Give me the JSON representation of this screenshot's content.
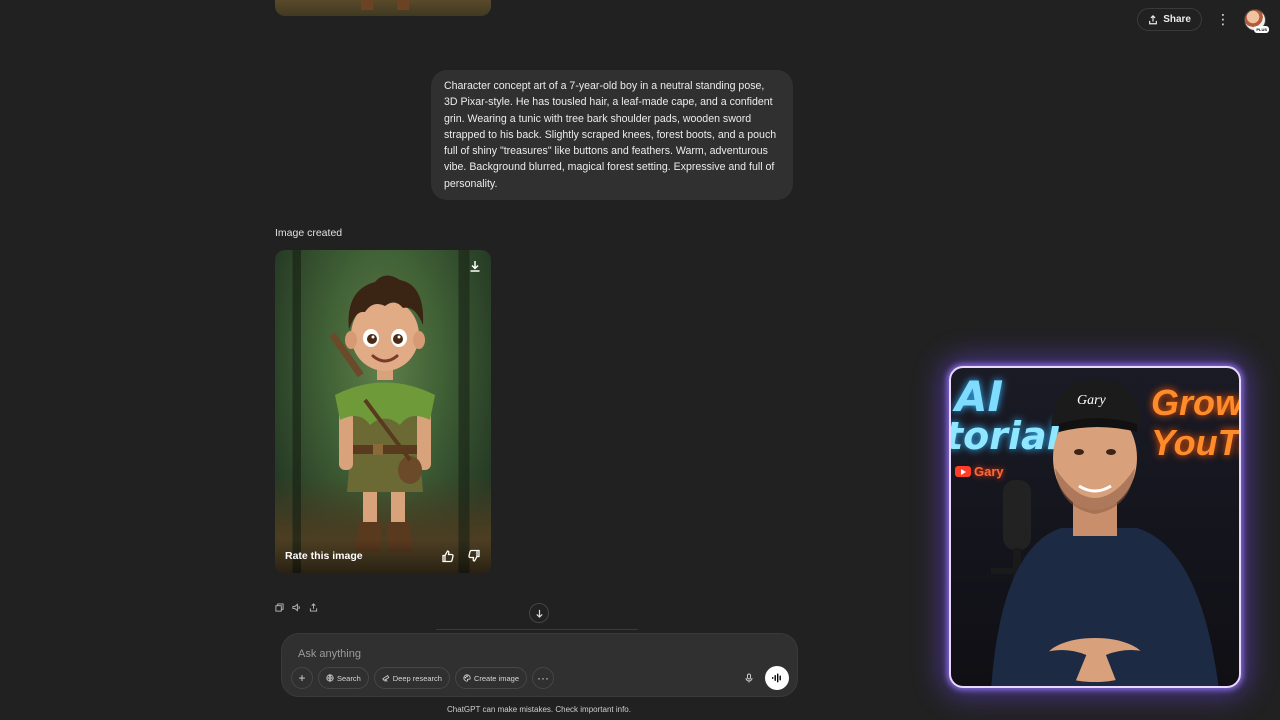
{
  "header": {
    "share_label": "Share",
    "more_icon": "more-vertical-icon",
    "avatar_badge": "PLUS"
  },
  "conversation": {
    "user_prompt": "Character concept art of a 7-year-old boy in a neutral standing pose, 3D Pixar-style. He has tousled hair, a leaf-made cape, and a confident grin. Wearing a tunic with tree bark shoulder pads, wooden sword strapped to his back. Slightly scraped knees, forest boots, and a pouch full of shiny \"treasures\" like buttons and feathers. Warm, adventurous vibe. Background blurred, magical forest setting. Expressive and full of personality.",
    "image_status": "Image created",
    "image": {
      "rate_label": "Rate this image",
      "download_icon": "download-icon",
      "thumbs_up_icon": "thumbs-up-icon",
      "thumbs_down_icon": "thumbs-down-icon"
    },
    "message_actions": [
      "copy-icon",
      "read-aloud-icon",
      "share-icon"
    ]
  },
  "composer": {
    "placeholder": "Ask anything",
    "tools": [
      {
        "label": "Search",
        "icon": "globe-icon"
      },
      {
        "label": "Deep research",
        "icon": "telescope-icon"
      },
      {
        "label": "Create image",
        "icon": "palette-icon"
      }
    ],
    "more_tools": "···",
    "add_label": "+"
  },
  "disclaimer": "ChatGPT can make mistakes. Check important info.",
  "webcam": {
    "neon_left_1": "AI",
    "neon_left_2": "torial",
    "neon_right_1": "Grow o",
    "neon_right_2": "YouTul",
    "yt_channel": "Gary",
    "cap_text": "Gary",
    "glow_color": "#7c5cff"
  }
}
